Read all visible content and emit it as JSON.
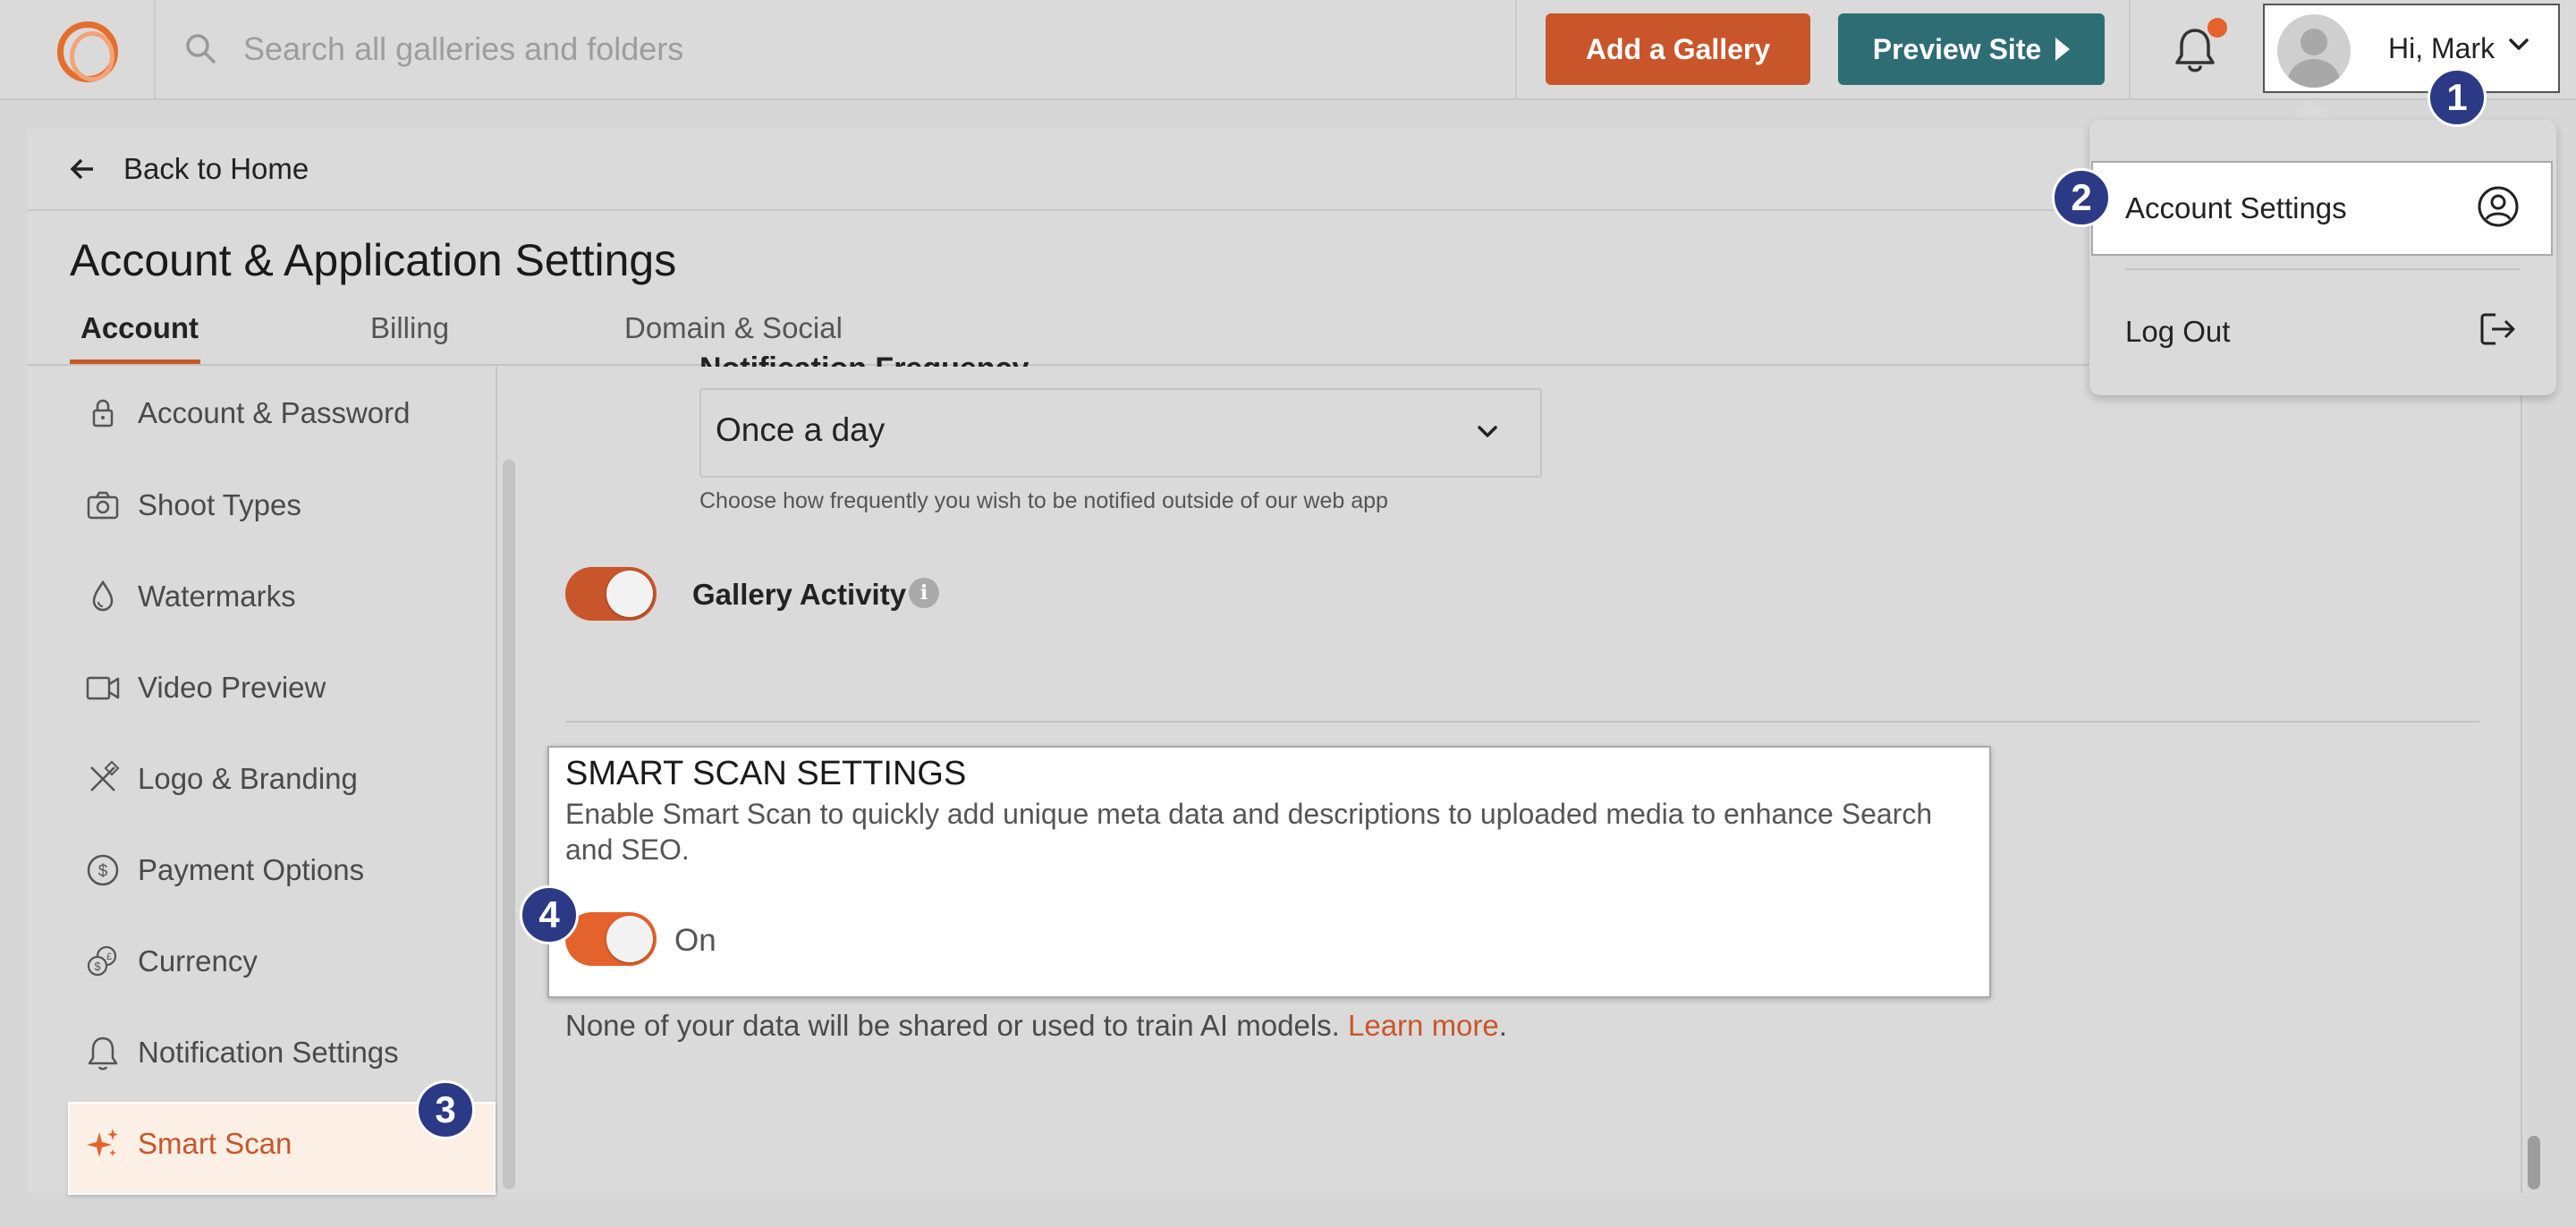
{
  "header": {
    "search_placeholder": "Search all galleries and folders",
    "add_gallery": "Add a Gallery",
    "preview_site": "Preview Site",
    "user_greeting": "Hi, Mark"
  },
  "user_menu": {
    "items": [
      {
        "label": "Account Settings",
        "icon": "user-circle-icon"
      },
      {
        "label": "Log Out",
        "icon": "logout-icon"
      }
    ]
  },
  "nav": {
    "back_label": "Back to Home",
    "page_title": "Account & Application Settings",
    "tabs": [
      {
        "label": "Account",
        "active": true
      },
      {
        "label": "Billing",
        "active": false
      },
      {
        "label": "Domain & Social",
        "active": false
      }
    ]
  },
  "sidebar": {
    "items": [
      {
        "label": "Account & Password",
        "icon": "lock-icon"
      },
      {
        "label": "Shoot Types",
        "icon": "camera-icon"
      },
      {
        "label": "Watermarks",
        "icon": "droplet-icon"
      },
      {
        "label": "Video Preview",
        "icon": "video-icon"
      },
      {
        "label": "Logo & Branding",
        "icon": "brush-icon"
      },
      {
        "label": "Payment Options",
        "icon": "dollar-circle-icon"
      },
      {
        "label": "Currency",
        "icon": "coins-icon"
      },
      {
        "label": "Notification Settings",
        "icon": "bell-icon"
      },
      {
        "label": "Smart Scan",
        "icon": "sparkle-icon",
        "active": true
      }
    ]
  },
  "notifications": {
    "frequency_label": "Notification Frequency",
    "frequency_value": "Once a day",
    "frequency_help": "Choose how frequently you wish to be notified outside of our web app",
    "gallery_activity_label": "Gallery Activity",
    "gallery_activity_on": true
  },
  "smart_scan": {
    "title": "SMART SCAN SETTINGS",
    "description": "Enable Smart Scan to quickly add unique meta data and descriptions to uploaded media to enhance Search and SEO.",
    "toggle_label": "On",
    "enabled": true,
    "note": "None of your data will be shared or used to train AI models.",
    "learn_more": "Learn more",
    "note_end": "."
  },
  "badges": [
    "1",
    "2",
    "3",
    "4"
  ],
  "colors": {
    "brand_orange": "#c9562a",
    "toggle_orange": "#e4622b",
    "preview_teal": "#2e6d73",
    "badge_navy": "#2c3a85"
  }
}
